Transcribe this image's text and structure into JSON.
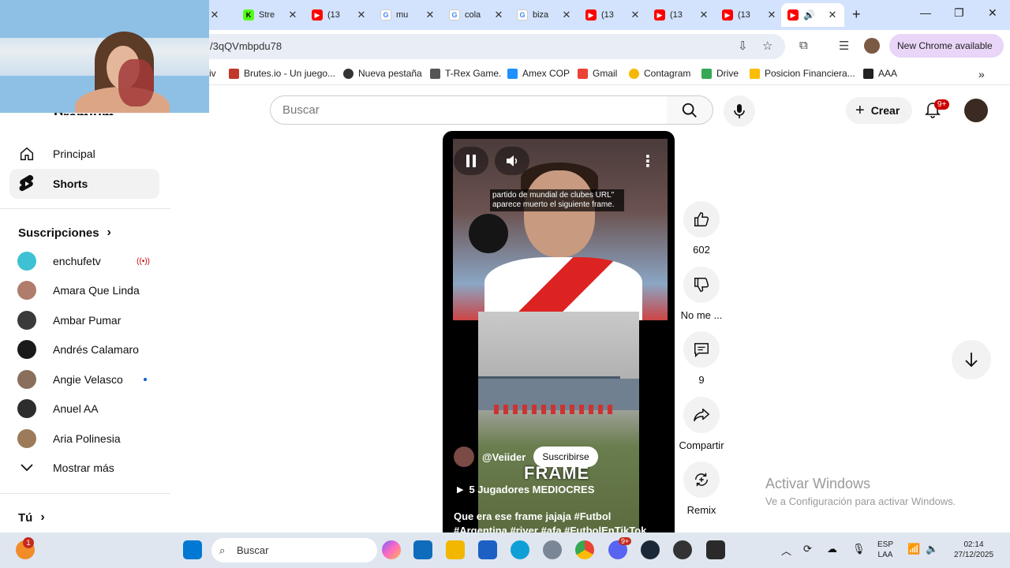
{
  "browser": {
    "tabs": [
      {
        "label": "",
        "icon": "tab-icon"
      },
      {
        "label": "Stre",
        "icon": "kick-icon"
      },
      {
        "label": "(13",
        "icon": "youtube-icon"
      },
      {
        "label": "mu",
        "icon": "google-icon"
      },
      {
        "label": "cola",
        "icon": "google-icon"
      },
      {
        "label": "biza",
        "icon": "google-icon"
      },
      {
        "label": "(13",
        "icon": "youtube-icon"
      },
      {
        "label": "(13",
        "icon": "youtube-icon"
      },
      {
        "label": "(13",
        "icon": "youtube-icon"
      }
    ],
    "address": "/3qQVmbpdu78",
    "update_label": "New Chrome available",
    "bookmarks": [
      {
        "label": "iv"
      },
      {
        "label": "Brutes.io - Un juego..."
      },
      {
        "label": "Nueva pestaña"
      },
      {
        "label": "T-Rex Game."
      },
      {
        "label": "Amex COP"
      },
      {
        "label": "Gmail"
      },
      {
        "label": "Contagram"
      },
      {
        "label": "Drive"
      },
      {
        "label": "Posicion Financiera..."
      },
      {
        "label": "AAA"
      }
    ]
  },
  "header": {
    "logo_text": "Premium",
    "search_placeholder": "Buscar",
    "create_label": "Crear",
    "notifications_badge": "9+"
  },
  "sidebar": {
    "main_items": [
      {
        "label": "Principal",
        "icon": "home-icon"
      },
      {
        "label": "Shorts",
        "icon": "shorts-icon",
        "active": true
      }
    ],
    "subscriptions_heading": "Suscripciones",
    "subscriptions": [
      {
        "label": "enchufetv",
        "status": "live",
        "color": "#3ec1d3"
      },
      {
        "label": "Amara Que Linda",
        "color": "#b07d6c"
      },
      {
        "label": "Ambar Pumar",
        "color": "#3a3a3a"
      },
      {
        "label": "Andrés Calamaro",
        "color": "#1a1a1a"
      },
      {
        "label": "Angie Velasco",
        "status": "new",
        "color": "#8a6f5c"
      },
      {
        "label": "Anuel AA",
        "color": "#2d2d2d"
      },
      {
        "label": "Aria Polinesia",
        "color": "#9c7a5a"
      }
    ],
    "show_more_label": "Mostrar más",
    "you_heading": "Tú"
  },
  "short": {
    "caption": "partido de mundial de clubes URL\" aparece muerto el siguiente frame.",
    "overlay_text": "FRAME",
    "channel": "@Veiider",
    "subscribe_label": "Suscribirse",
    "playlist": "5 Jugadores MEDIOCRES",
    "title": "Que era ese frame jajaja #Futbol #Argentina #river #afa #FutbolEnTikTok"
  },
  "actions": {
    "likes": "602",
    "dislike_label": "No me ...",
    "comments": "9",
    "share_label": "Compartir",
    "remix_label": "Remix"
  },
  "watermark": {
    "line1": "Activar Windows",
    "line2": "Ve a Configuración para activar Windows."
  },
  "taskbar": {
    "weather_badge": "1",
    "search_label": "Buscar",
    "discord_badge": "9+",
    "lang_top": "ESP",
    "lang_bottom": "LAA",
    "time": "02:14",
    "date": "27/12/2025"
  }
}
